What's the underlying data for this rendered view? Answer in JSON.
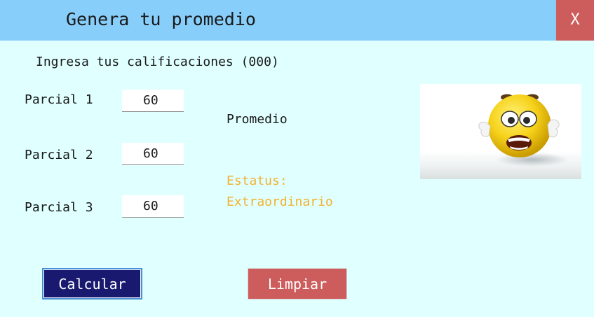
{
  "window": {
    "title": "Genera tu promedio",
    "close_label": "X"
  },
  "form": {
    "instructions": "Ingresa tus calificaciones (000)",
    "partials": [
      {
        "label": "Parcial 1",
        "value": "60"
      },
      {
        "label": "Parcial 2",
        "value": "60"
      },
      {
        "label": "Parcial 3",
        "value": "60"
      }
    ]
  },
  "result": {
    "promedio_label": "Promedio",
    "status_line1": "Estatus:",
    "status_line2": "Extraordinario",
    "status_color": "#f2b230",
    "image": "worried-emoji-icon"
  },
  "buttons": {
    "calcular": "Calcular",
    "limpiar": "Limpiar"
  },
  "colors": {
    "titlebar": "#87cefa",
    "background": "#e0ffff",
    "close": "#cd5c5c",
    "calcular": "#191970",
    "limpiar": "#cd5c5c"
  }
}
